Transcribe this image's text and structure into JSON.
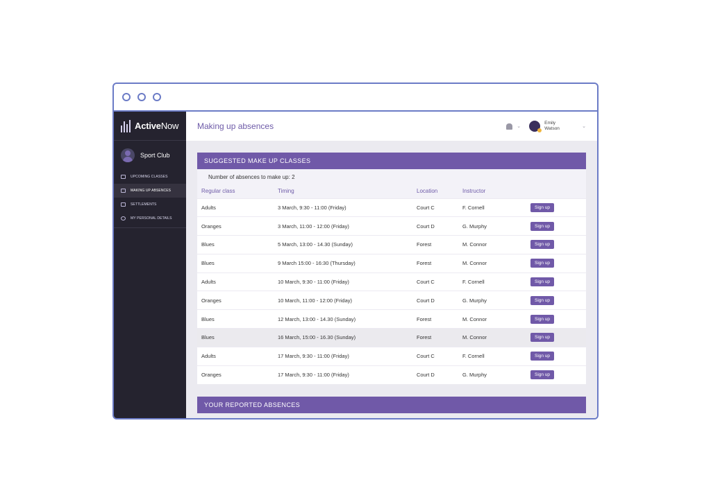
{
  "window": {
    "controls": [
      "dot",
      "dot",
      "dot"
    ]
  },
  "brand": {
    "name_bold": "Active",
    "name_regular": "Now"
  },
  "club": {
    "name": "Sport Club"
  },
  "nav": [
    {
      "label": "UPCOMING CLASSES",
      "icon": "calendar-icon"
    },
    {
      "label": "MAKING UP ABSENCES",
      "icon": "calendar-check-icon",
      "active": true
    },
    {
      "label": "SETTLEMENTS",
      "icon": "wallet-icon"
    },
    {
      "label": "MY PERSONAL DETAILS",
      "icon": "gear-icon"
    }
  ],
  "header": {
    "title": "Making up absences",
    "user_first": "Emily",
    "user_last": "Watson"
  },
  "suggested": {
    "title": "SUGGESTED MAKE UP CLASSES",
    "note": "Number of absences to make up: 2",
    "columns": [
      "Regular class",
      "Timing",
      "Location",
      "Instructor"
    ],
    "button_label": "Sign up",
    "rows": [
      {
        "cls": "Adults",
        "timing": "3 March, 9:30 - 11:00 (Friday)",
        "location": "Court C",
        "instructor": "F. Cornell"
      },
      {
        "cls": "Oranges",
        "timing": "3 March, 11:00 - 12:00 (Friday)",
        "location": "Court D",
        "instructor": "G. Murphy"
      },
      {
        "cls": "Blues",
        "timing": "5 March, 13:00 - 14.30 (Sunday)",
        "location": "Forest",
        "instructor": "M. Connor"
      },
      {
        "cls": "Blues",
        "timing": "9 March 15:00 - 16:30 (Thursday)",
        "location": "Forest",
        "instructor": "M. Connor"
      },
      {
        "cls": "Adults",
        "timing": "10 March, 9:30 - 11:00 (Friday)",
        "location": "Court C",
        "instructor": "F. Cornell"
      },
      {
        "cls": "Oranges",
        "timing": "10 March, 11:00 - 12:00 (Friday)",
        "location": "Court D",
        "instructor": "G. Murphy"
      },
      {
        "cls": "Blues",
        "timing": "12 March, 13:00 - 14.30 (Sunday)",
        "location": "Forest",
        "instructor": "M. Connor"
      },
      {
        "cls": "Blues",
        "timing": "16 March, 15:00 - 16.30 (Sunday)",
        "location": "Forest",
        "instructor": "M. Connor",
        "highlight": true
      },
      {
        "cls": "Adults",
        "timing": "17 March, 9:30 - 11:00 (Friday)",
        "location": "Court C",
        "instructor": "F. Cornell"
      },
      {
        "cls": "Oranges",
        "timing": "17 March, 9:30 - 11:00 (Friday)",
        "location": "Court D",
        "instructor": "G. Murphy"
      }
    ]
  },
  "reported": {
    "title": "YOUR REPORTED ABSENCES"
  },
  "colors": {
    "accent": "#7059a8",
    "sidebar": "#25232f",
    "frame": "#6b7bc6"
  }
}
